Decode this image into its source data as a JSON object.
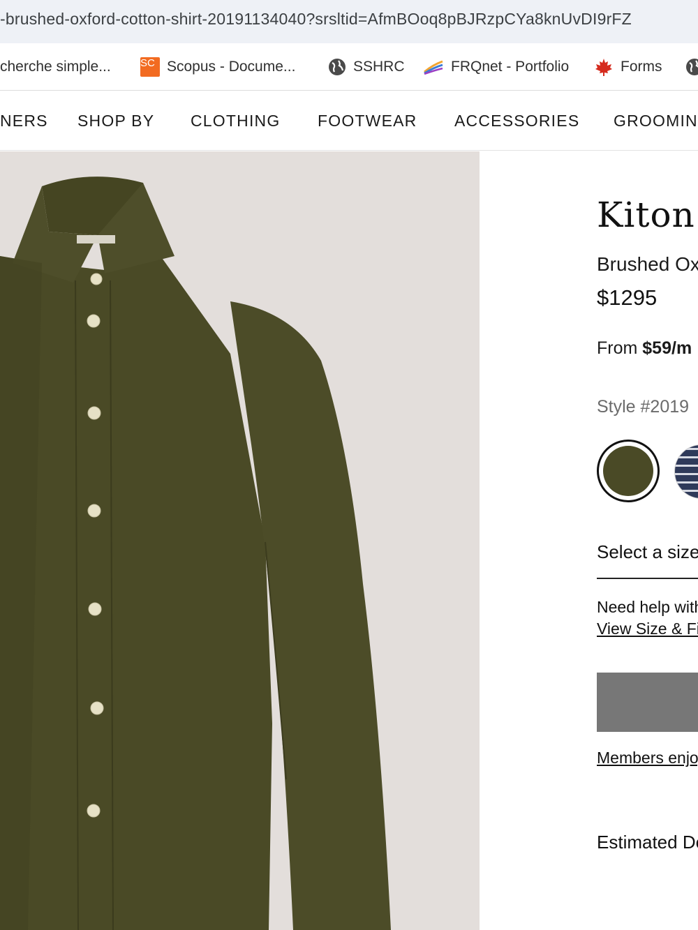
{
  "browser": {
    "url": "-brushed-oxford-cotton-shirt-20191134040?srsltid=AfmBOoq8pBJRzpCYa8knUvDI9rFZ",
    "bookmarks": [
      {
        "label": "cherche simple...",
        "icon": "none"
      },
      {
        "label": "Scopus - Docume...",
        "icon": "scopus-icon",
        "badge": "SC"
      },
      {
        "label": "SSHRC",
        "icon": "globe-icon"
      },
      {
        "label": "FRQnet - Portfolio",
        "icon": "frq-icon"
      },
      {
        "label": "Forms",
        "icon": "maple-leaf-icon"
      }
    ]
  },
  "nav": {
    "items": [
      "NERS",
      "SHOP BY",
      "CLOTHING",
      "FOOTWEAR",
      "ACCESSORIES",
      "GROOMING"
    ]
  },
  "product": {
    "brand": "Kiton",
    "name": "Brushed Oxford",
    "price": "$1295",
    "financing_prefix": "From ",
    "financing_amount": "$59/m",
    "style": "Style #2019",
    "swatches": [
      {
        "name": "olive",
        "color": "#4a4a26",
        "selected": true
      },
      {
        "name": "navy-stripe",
        "color": "#2f3a5a",
        "selected": false
      }
    ],
    "size_select": "Select a size",
    "help_text": "Need help with",
    "help_link": "View Size & Fit",
    "members_text": "Members enjoy",
    "delivery_text": "Estimated Delivery"
  },
  "colors": {
    "image_background": "#e3dedb",
    "shirt": "#4a4a26",
    "button_disabled": "#777777"
  }
}
